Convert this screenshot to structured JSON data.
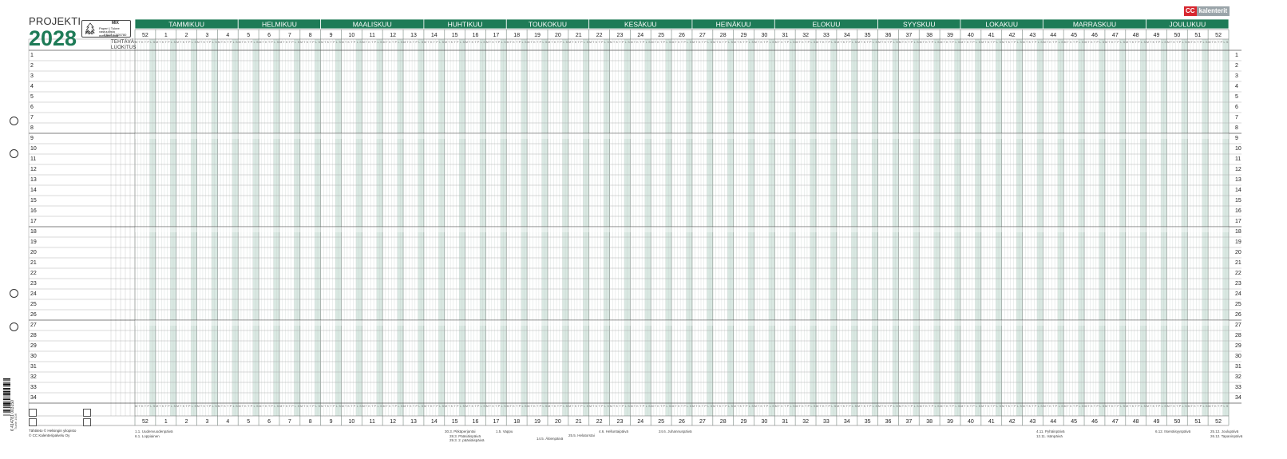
{
  "title": {
    "subtitle": "PROJEKTI",
    "year": "2028"
  },
  "fsc": {
    "label": "FSC",
    "mix": "MIX",
    "line1": "Paperi | Tukee",
    "line2": "vastuullista metsänhoitoa",
    "code": "FSC® C005780"
  },
  "brand": {
    "cc": "CC",
    "kalenterit": "kalenterit"
  },
  "corner_label": [
    "TEHTÄVÄ-",
    "LUOKITUS"
  ],
  "months": [
    "TAMMIKUU",
    "HELMIKUU",
    "MAALISKUU",
    "HUHTIKUU",
    "TOUKOKUU",
    "KESÄKUU",
    "HEINÄKUU",
    "ELOKUU",
    "SYYSKUU",
    "LOKAKUU",
    "MARRASKUU",
    "JOULUKUU"
  ],
  "weeks": [
    "52",
    "1",
    "2",
    "3",
    "4",
    "5",
    "6",
    "7",
    "8",
    "9",
    "10",
    "11",
    "12",
    "13",
    "14",
    "15",
    "16",
    "17",
    "18",
    "19",
    "20",
    "21",
    "22",
    "23",
    "24",
    "25",
    "26",
    "27",
    "28",
    "29",
    "30",
    "31",
    "32",
    "33",
    "34",
    "35",
    "36",
    "37",
    "38",
    "39",
    "40",
    "41",
    "42",
    "43",
    "44",
    "45",
    "46",
    "47",
    "48",
    "49",
    "50",
    "51",
    "52"
  ],
  "rows": [
    "1",
    "2",
    "3",
    "4",
    "5",
    "6",
    "7",
    "8",
    "9",
    "10",
    "11",
    "12",
    "13",
    "14",
    "15",
    "16",
    "17",
    "18",
    "19",
    "20",
    "21",
    "22",
    "23",
    "24",
    "25",
    "26",
    "27",
    "28",
    "29",
    "30",
    "31",
    "32",
    "33",
    "34"
  ],
  "weekday_letters": [
    "M",
    "T",
    "K",
    "T",
    "P",
    "L",
    "S"
  ],
  "footer_left": [
    "Tähtiteto © Helsingin yliopisto",
    "© CC Kalenteripalvelu Oy"
  ],
  "holidays": [
    [
      "1.1. Uudenvuodenpäivä",
      "6.1. Loppiainen"
    ],
    [
      "30.3. Pitkäperjantai",
      "28.3. Pääsiäispäivä",
      "29.3. 2. pääsiäispäivä"
    ],
    [
      "1.5. Vappu"
    ],
    [
      "14.5. Äitienpäivä"
    ],
    [
      "25.5. Helatorstai"
    ],
    [
      "4.6. Helluntaipäivä"
    ],
    [
      "24.6. Juhannuspäivä"
    ],
    [
      "4.11. Pyhäinpäivä",
      "12.11. Isänpäivä"
    ],
    [
      "6.12. Itsenäisyyspäivä"
    ],
    [
      "25.12. Joulupäivä",
      "26.12. Tapaninpäivä"
    ]
  ],
  "barcode_number": "6 414781 003150",
  "edition_code": "Tuote 1006",
  "colors": {
    "accent": "#1e7b57",
    "stripe": "#b9d6ca",
    "line": "#9aa5a0",
    "brand_red": "#d7272f"
  }
}
